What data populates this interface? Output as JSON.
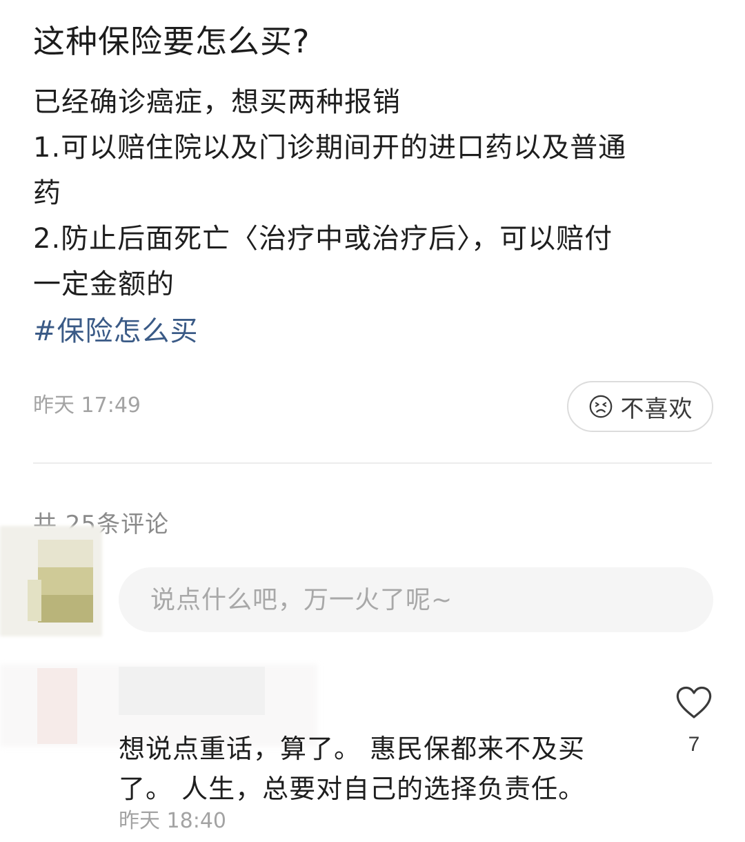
{
  "post": {
    "title": "这种保险要怎么买?",
    "body_lines": [
      "已经确诊癌症，想买两种报销",
      "1.可以赔住院以及门诊期间开的进口药以及普通",
      "药",
      "2.防止后面死亡〈治疗中或治疗后〉，可以赔付",
      "一定金额的"
    ],
    "hashtag": "#保险怎么买",
    "time": "昨天 17:49",
    "dislike_label": "不喜欢",
    "dislike_icon": "frown-face-icon"
  },
  "comments": {
    "count_label": "共 25条评论",
    "input_placeholder": "说点什么吧，万一火了呢~",
    "items": [
      {
        "text_lines": [
          "想说点重话，算了。 惠民保都来不及买",
          "了。 人生，总要对自己的选择负责任。"
        ],
        "time": "昨天 18:40",
        "like_count": "7",
        "like_icon": "heart-outline-icon"
      }
    ]
  },
  "colors": {
    "hashtag": "#3a5a86",
    "muted": "#a3a3a3",
    "divider": "#ececec",
    "input_bg": "#f5f5f5"
  }
}
